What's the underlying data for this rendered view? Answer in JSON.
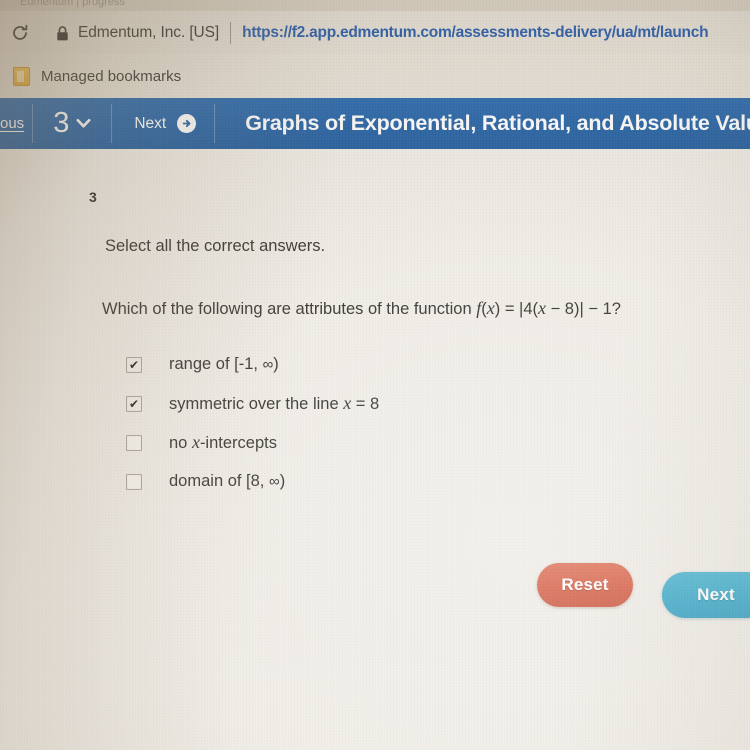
{
  "browser": {
    "reload_icon": "reload-icon",
    "lock_icon": "lock-icon",
    "site_identity": "Edmentum, Inc. [US]",
    "url": "https://f2.app.edmentum.com/assessments-delivery/ua/mt/launch",
    "bookmarks": {
      "folder_icon": "folder-icon",
      "label": "Managed bookmarks"
    },
    "top_sliver_ghost": "Edmentum  |  progress"
  },
  "navbar": {
    "previous_label": "ous",
    "question_number": "3",
    "chevron_icon": "chevron-down-icon",
    "next_label": "Next",
    "next_arrow_icon": "arrow-right-circle-icon",
    "title": "Graphs of Exponential, Rational, and Absolute Value",
    "background_color": "#1c5da4"
  },
  "question": {
    "number": "3",
    "instruction": "Select all the correct answers.",
    "prompt_prefix": "Which of the following are attributes of the function ",
    "prompt_func": "f",
    "prompt_open": "(",
    "prompt_var": "x",
    "prompt_close": ") = |4(",
    "prompt_var2": "x",
    "prompt_tail": " − 8)| − 1?",
    "options": [
      {
        "id": "range",
        "checked": true,
        "check_glyph": "✔",
        "text_before": "range of [-1, ",
        "infinity": "∞",
        "text_after": ")"
      },
      {
        "id": "symmetric",
        "checked": true,
        "check_glyph": "✔",
        "text_before": "symmetric over the line ",
        "var": "x",
        "text_after": " = 8"
      },
      {
        "id": "no-x-intercepts",
        "checked": false,
        "check_glyph": "",
        "text_before": "no ",
        "var": "x",
        "text_after": "-intercepts"
      },
      {
        "id": "domain",
        "checked": false,
        "check_glyph": "",
        "text_before": "domain of [8, ",
        "infinity": "∞",
        "text_after": ")"
      }
    ]
  },
  "actions": {
    "reset_label": "Reset",
    "reset_color": "#d3563c",
    "next_label": "Next",
    "next_color": "#33a6c8"
  }
}
